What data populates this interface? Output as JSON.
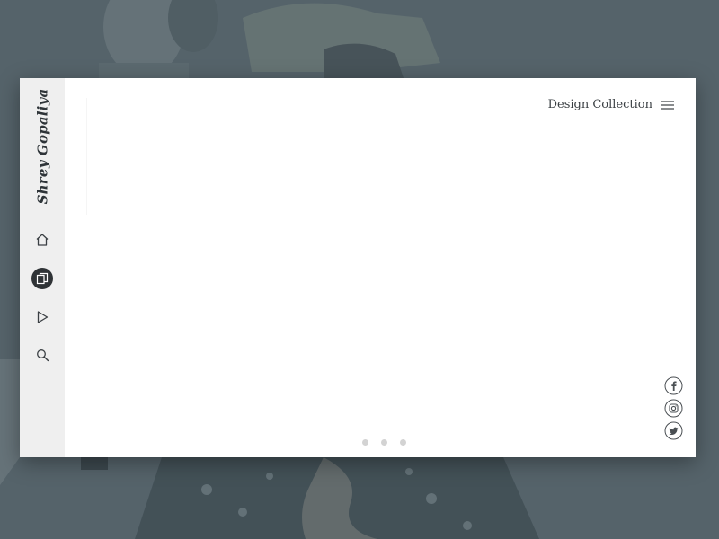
{
  "brand": {
    "name": "Shrey Gopaliya"
  },
  "sidebar": {
    "items": [
      {
        "name": "home",
        "icon": "home-icon",
        "active": false
      },
      {
        "name": "collection",
        "icon": "copy-icon",
        "active": true
      },
      {
        "name": "play",
        "icon": "play-icon",
        "active": false
      },
      {
        "name": "search",
        "icon": "search-icon",
        "active": false
      }
    ]
  },
  "header": {
    "menu_label": "Design Collection",
    "menu_icon": "hamburger-icon"
  },
  "social": [
    {
      "name": "facebook",
      "icon": "facebook-icon"
    },
    {
      "name": "instagram",
      "icon": "instagram-icon"
    },
    {
      "name": "twitter",
      "icon": "twitter-icon"
    }
  ],
  "pagination": {
    "count": 3
  },
  "colors": {
    "backdrop": "#55636b",
    "sidebar": "#efefef",
    "active": "#2f3336",
    "text": "#3a3f43",
    "dot": "#d3d3d3"
  }
}
